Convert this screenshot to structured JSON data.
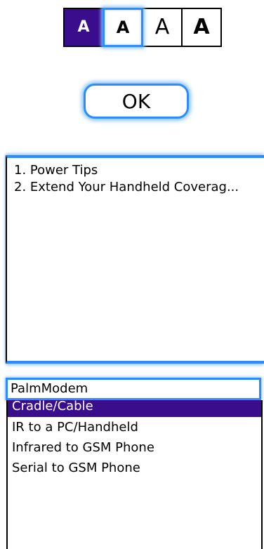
{
  "font_selector": {
    "options": [
      "A",
      "A",
      "A",
      "A"
    ],
    "selected_index": 0,
    "focused_index": 1
  },
  "ok_button": {
    "label": "OK"
  },
  "tips_list": {
    "items": [
      "1. Power Tips",
      "2. Extend Your Handheld Coverag..."
    ]
  },
  "connection": {
    "field_value": "PalmModem",
    "options": [
      "Cradle/Cable",
      "IR to a PC/Handheld",
      "Infrared to GSM Phone",
      "Serial to GSM Phone"
    ],
    "selected_index": 0
  },
  "colors": {
    "selection": "#3a0d8c",
    "focus_ring": "#2c8cff"
  }
}
